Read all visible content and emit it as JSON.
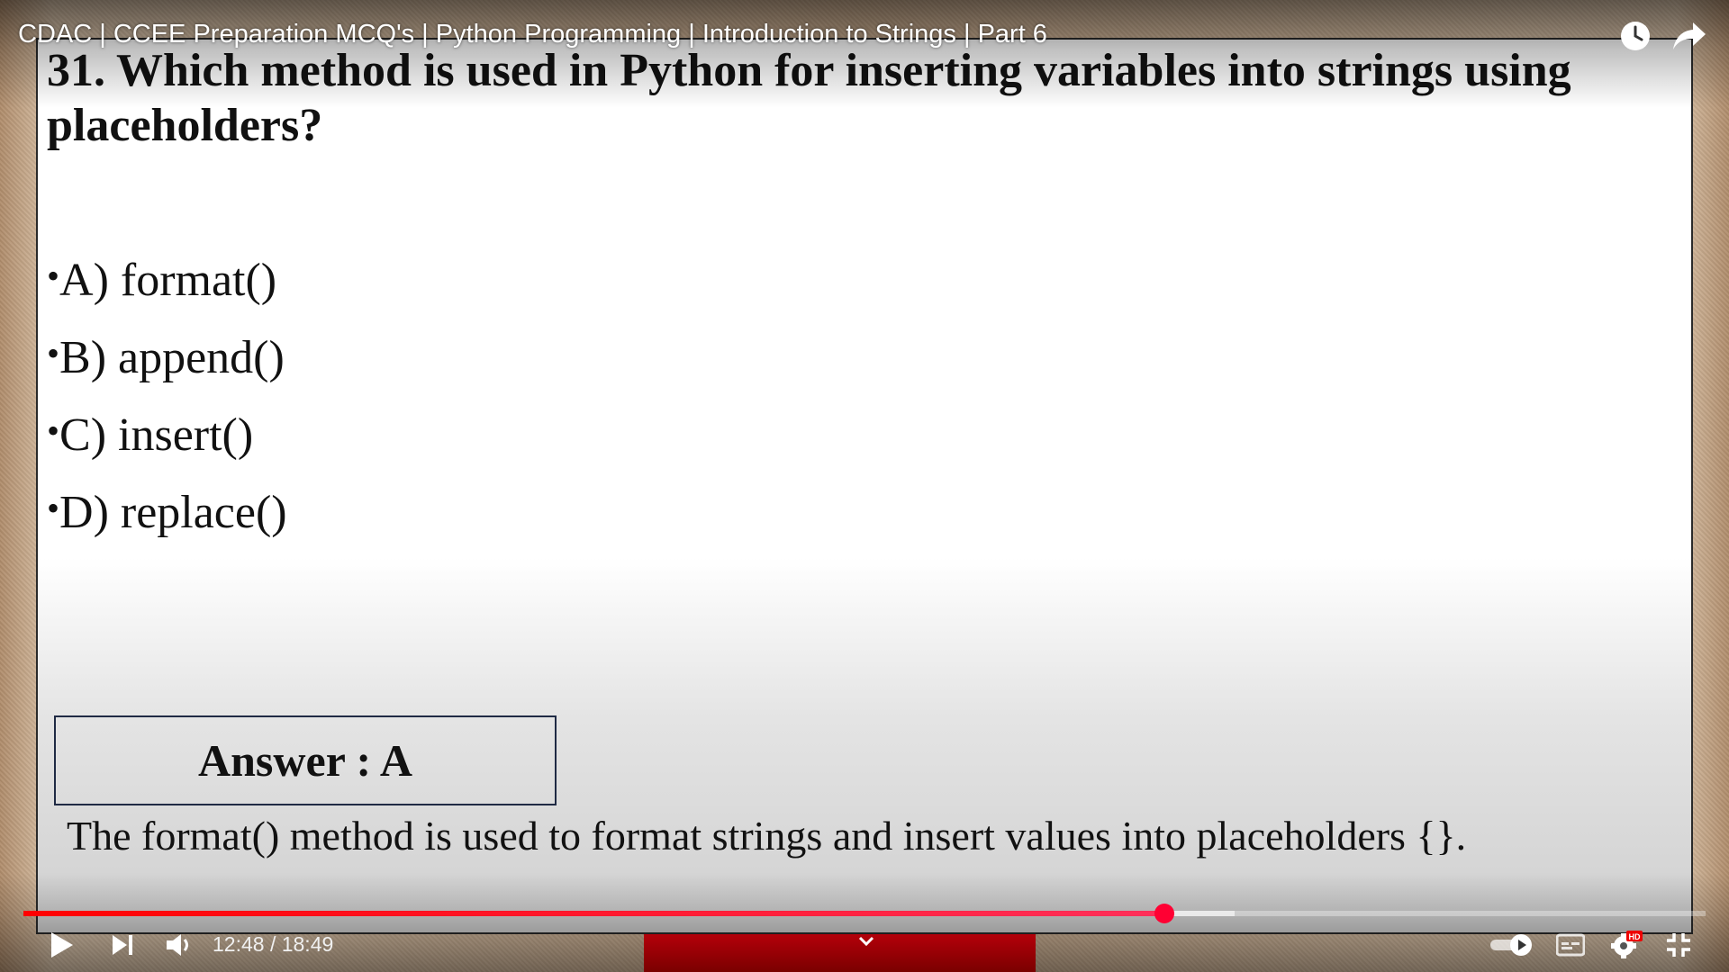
{
  "video": {
    "title": "CDAC | CCEE Preparation MCQ's | Python Programming | Introduction to Strings | Part 6"
  },
  "slide": {
    "question": "31. Which method is used in Python for inserting variables into strings using placeholders?",
    "options": [
      {
        "bullet": "•",
        "text": "A) format()"
      },
      {
        "bullet": "•",
        "text": "B) append()"
      },
      {
        "bullet": "•",
        "text": "C) insert()"
      },
      {
        "bullet": "•",
        "text": "D) replace()"
      }
    ],
    "answer": "Answer : A",
    "explanation": "The format() method is used to format strings and insert values into placeholders {}."
  },
  "player": {
    "time_display": "12:48 / 18:49",
    "current_time": "12:48",
    "duration": "18:49",
    "played_fraction": 0.6785,
    "buffered_fraction": 0.72,
    "quality_badge": "HD",
    "accent_color": "#ff0033",
    "icons": {
      "watch_later": "clock-icon",
      "share": "share-icon",
      "play": "play-icon",
      "next": "next-icon",
      "volume": "volume-icon",
      "autoplay": "autoplay-toggle-icon",
      "captions": "captions-icon",
      "settings": "gear-icon",
      "fullscreen_exit": "exit-fullscreen-icon",
      "expand": "chevron-down-icon"
    }
  }
}
